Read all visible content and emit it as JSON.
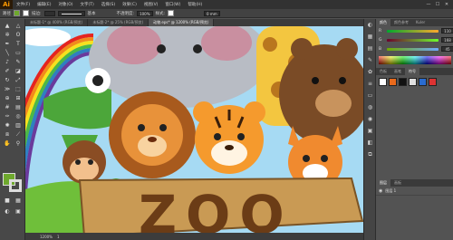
{
  "app": {
    "logo": "Ai"
  },
  "menu": {
    "items": [
      "文件(F)",
      "编辑(E)",
      "对象(O)",
      "文字(T)",
      "选择(S)",
      "效果(C)",
      "视图(V)",
      "窗口(W)",
      "帮助(H)"
    ],
    "window_controls": [
      "—",
      "☐",
      "✕"
    ]
  },
  "control_bar": {
    "selection_label": "路径",
    "stroke_label": "描边:",
    "stroke_value": "",
    "style_label": "基本",
    "opacity_label": "不透明度:",
    "opacity_value": "100%",
    "style2_label": "样式:",
    "width_value": "0 mm",
    "fill_color": "#6ea82d"
  },
  "tabs": [
    {
      "label": "未标题-1* @ 400% (RGB/预览)",
      "active": false
    },
    {
      "label": "未标题-2* @ 25% (RGB/预览)",
      "active": false
    },
    {
      "label": "动物.eps* @ 1200% (RGB/预览)",
      "active": true
    }
  ],
  "toolbar": {
    "tools": [
      "selection-tool",
      "direct-selection-tool",
      "magic-wand-tool",
      "lasso-tool",
      "pen-tool",
      "type-tool",
      "line-tool",
      "rectangle-tool",
      "paintbrush-tool",
      "pencil-tool",
      "blob-brush-tool",
      "eraser-tool",
      "rotate-tool",
      "scale-tool",
      "width-tool",
      "free-transform-tool",
      "shape-builder-tool",
      "perspective-grid-tool",
      "mesh-tool",
      "gradient-tool",
      "eyedropper-tool",
      "blend-tool",
      "symbol-sprayer-tool",
      "column-graph-tool",
      "artboard-tool",
      "slice-tool",
      "hand-tool",
      "zoom-tool"
    ],
    "fill_color": "#6ea82d"
  },
  "panels": {
    "color_tabs": [
      "颜色",
      "颜色参考",
      "Kuler"
    ],
    "sliders": [
      {
        "label": "R",
        "value": "110"
      },
      {
        "label": "G",
        "value": "168"
      },
      {
        "label": "B",
        "value": "45"
      }
    ],
    "swatch_tabs": [
      "色板",
      "画笔",
      "符号"
    ],
    "layers_tabs": [
      "图层",
      "画板"
    ],
    "layers": [
      {
        "name": "图层 1"
      }
    ]
  },
  "sign": {
    "text": "ZOO"
  },
  "colors": {
    "sky": "#9fd6f2",
    "grass": "#6fbf3a",
    "wood": "#c99a54",
    "tiger": "#f59a2d",
    "lion": "#e8923a"
  },
  "status": {
    "zoom": "1200%",
    "page": "1"
  }
}
